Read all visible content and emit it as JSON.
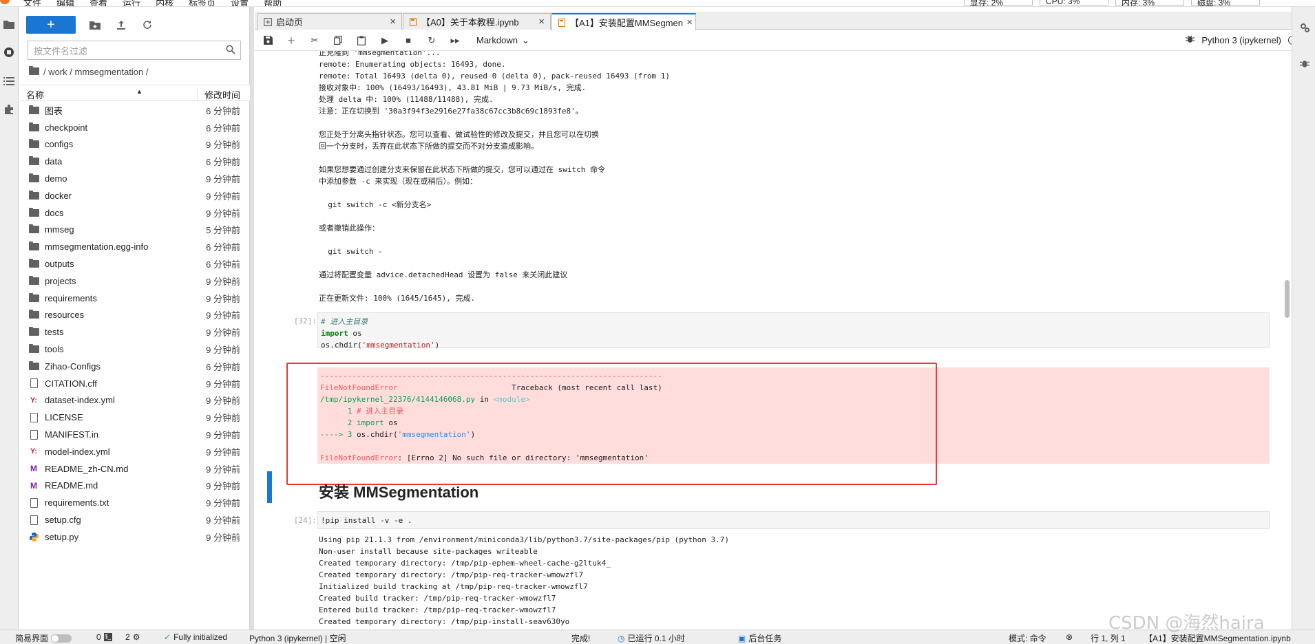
{
  "menu": {
    "items": [
      "文件",
      "编辑",
      "查看",
      "运行",
      "内核",
      "标签页",
      "设置",
      "帮助"
    ]
  },
  "metrics": {
    "gpu": "显存: 2%",
    "cpu": "CPU: 3%",
    "mem": "内存: 3%",
    "disk": "磁盘: 3%"
  },
  "filebrowser": {
    "new_label": "+",
    "filter_placeholder": "按文件名过滤",
    "breadcrumb": "/ work / mmsegmentation /",
    "col_name": "名称",
    "col_modified": "修改时间",
    "items": [
      {
        "name": "图表",
        "time": "6 分钟前",
        "type": "folder"
      },
      {
        "name": "checkpoint",
        "time": "6 分钟前",
        "type": "folder"
      },
      {
        "name": "configs",
        "time": "9 分钟前",
        "type": "folder"
      },
      {
        "name": "data",
        "time": "6 分钟前",
        "type": "folder"
      },
      {
        "name": "demo",
        "time": "9 分钟前",
        "type": "folder"
      },
      {
        "name": "docker",
        "time": "9 分钟前",
        "type": "folder"
      },
      {
        "name": "docs",
        "time": "9 分钟前",
        "type": "folder"
      },
      {
        "name": "mmseg",
        "time": "5 分钟前",
        "type": "folder"
      },
      {
        "name": "mmsegmentation.egg-info",
        "time": "6 分钟前",
        "type": "folder"
      },
      {
        "name": "outputs",
        "time": "6 分钟前",
        "type": "folder"
      },
      {
        "name": "projects",
        "time": "9 分钟前",
        "type": "folder"
      },
      {
        "name": "requirements",
        "time": "9 分钟前",
        "type": "folder"
      },
      {
        "name": "resources",
        "time": "9 分钟前",
        "type": "folder"
      },
      {
        "name": "tests",
        "time": "9 分钟前",
        "type": "folder"
      },
      {
        "name": "tools",
        "time": "9 分钟前",
        "type": "folder"
      },
      {
        "name": "Zihao-Configs",
        "time": "6 分钟前",
        "type": "folder"
      },
      {
        "name": "CITATION.cff",
        "time": "9 分钟前",
        "type": "file"
      },
      {
        "name": "dataset-index.yml",
        "time": "9 分钟前",
        "type": "yaml"
      },
      {
        "name": "LICENSE",
        "time": "9 分钟前",
        "type": "file"
      },
      {
        "name": "MANIFEST.in",
        "time": "9 分钟前",
        "type": "file"
      },
      {
        "name": "model-index.yml",
        "time": "9 分钟前",
        "type": "yaml"
      },
      {
        "name": "README_zh-CN.md",
        "time": "9 分钟前",
        "type": "markdown"
      },
      {
        "name": "README.md",
        "time": "9 分钟前",
        "type": "markdown"
      },
      {
        "name": "requirements.txt",
        "time": "9 分钟前",
        "type": "file"
      },
      {
        "name": "setup.cfg",
        "time": "9 分钟前",
        "type": "file"
      },
      {
        "name": "setup.py",
        "time": "9 分钟前",
        "type": "python"
      }
    ]
  },
  "tabs": [
    {
      "label": "启动页",
      "icon": "launcher-icon"
    },
    {
      "label": "【A0】关于本教程.ipynb",
      "icon": "notebook-icon"
    },
    {
      "label": "【A1】安装配置MMSegmen",
      "icon": "notebook-icon",
      "active": true
    }
  ],
  "toolbar": {
    "cell_type": "Markdown",
    "kernel": "Python 3 (ipykernel)"
  },
  "notebook": {
    "output1": "正克隆到 'mmsegmentation'...\nremote: Enumerating objects: 16493, done.\nremote: Total 16493 (delta 0), reused 0 (delta 0), pack-reused 16493 (from 1)\n接收对象中: 100% (16493/16493), 43.81 MiB | 9.73 MiB/s, 完成.\n处理 delta 中: 100% (11488/11488), 完成.\n注意：正在切换到 '30a3f94f3e2916e27fa38c67cc3b8c69c1893fe8'。\n\n您正处于分离头指针状态。您可以查看、做试验性的修改及提交，并且您可以在切换\n回一个分支时，丢弃在此状态下所做的提交而不对分支造成影响。\n\n如果您想要通过创建分支来保留在此状态下所做的提交，您可以通过在 switch 命令\n中添加参数 -c 来实现（现在或稍后）。例如：\n\n  git switch -c <新分支名>\n\n或者撤销此操作：\n\n  git switch -\n\n通过将配置变量 advice.detachedHead 设置为 false 来关闭此建议\n\n正在更新文件: 100% (1645/1645), 完成.",
    "cell32_prompt": "[32]:",
    "cell32_comment": "# 进入主目录",
    "cell32_import_kw": "import",
    "cell32_import_mod": " os",
    "cell32_call": "os.chdir(",
    "cell32_arg": "'mmsegmentation'",
    "cell32_close": ")",
    "err_dashes": "---------------------------------------------------------------------------",
    "err_type": "FileNotFoundError",
    "err_traceback": "                         Traceback (most recent call last)",
    "err_file": "/tmp/ipykernel_22376/4144146068.py",
    "err_in": " in ",
    "err_module": "<module>",
    "err_l1_no": "      1 ",
    "err_l1": "# 进入主目录",
    "err_l2_no": "      2 ",
    "err_l2_kw": "import",
    "err_l2": " os",
    "err_l3_arrow": "----> 3 ",
    "err_l3": "os.chdir(",
    "err_l3_arg": "'mmsegmentation'",
    "err_l3_close": ")",
    "err_final_type": "FileNotFoundError",
    "err_final_msg": ": [Errno 2] No such file or directory: 'mmsegmentation'",
    "md_heading": "安装 MMSegmentation",
    "cell24_prompt": "[24]:",
    "cell24_code": "!pip install -v -e .",
    "output2": "Using pip 21.1.3 from /environment/miniconda3/lib/python3.7/site-packages/pip (python 3.7)\nNon-user install because site-packages writeable\nCreated temporary directory: /tmp/pip-ephem-wheel-cache-g2ltuk4_\nCreated temporary directory: /tmp/pip-req-tracker-wmowzfl7\nInitialized build tracking at /tmp/pip-req-tracker-wmowzfl7\nCreated build tracker: /tmp/pip-req-tracker-wmowzfl7\nEntered build tracker: /tmp/pip-req-tracker-wmowzfl7\nCreated temporary directory: /tmp/pip-install-seav630yo"
  },
  "status": {
    "simple_mode": "简易界面",
    "terminals": "0",
    "kernels": "2",
    "init": "Fully initialized",
    "kernel_state": "Python 3 (ipykernel) | 空闲",
    "done": "完成!",
    "runtime": "已运行 0.1 小时",
    "bg_tasks": "后台任务",
    "mode": "模式: 命令",
    "position": "行 1, 列 1",
    "filename": "【A1】安装配置MMSegmentation.ipynb"
  },
  "watermark": "CSDN @海然haira",
  "colors": {
    "accent": "#1976d2",
    "error_bg": "#ffdddd",
    "highlight_frame": "#e53935"
  }
}
